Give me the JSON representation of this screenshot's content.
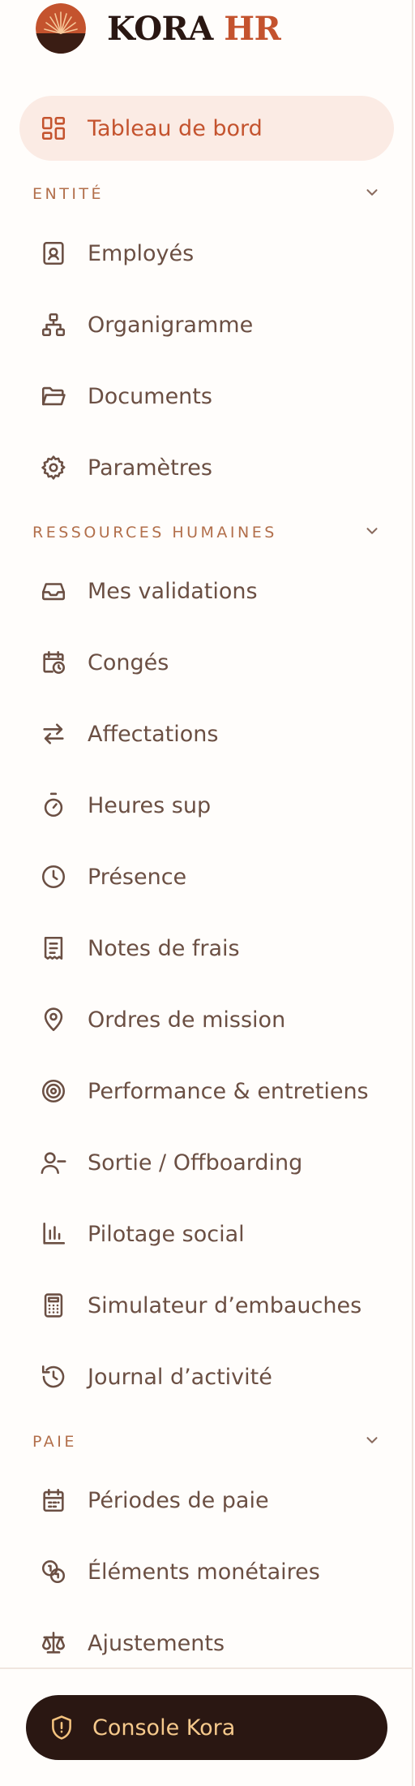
{
  "brand": {
    "name_part1": "KORA",
    "name_part2": "HR",
    "logo_icon": "sunrise-logo"
  },
  "colors": {
    "accent": "#c4532e",
    "active_bg": "#fbebe4",
    "text": "#6b4f43",
    "section": "#b26f4b",
    "dark": "#2a1712",
    "gold": "#f5c98c"
  },
  "nav": {
    "dashboard": {
      "label": "Tableau de bord",
      "icon": "grid-icon"
    },
    "sections": [
      {
        "label": "ENTITÉ",
        "items": [
          {
            "label": "Employés",
            "icon": "id-badge-icon"
          },
          {
            "label": "Organigramme",
            "icon": "org-chart-icon"
          },
          {
            "label": "Documents",
            "icon": "folder-icon"
          },
          {
            "label": "Paramètres",
            "icon": "gear-icon"
          }
        ]
      },
      {
        "label": "RESSOURCES HUMAINES",
        "items": [
          {
            "label": "Mes validations",
            "icon": "inbox-icon"
          },
          {
            "label": "Congés",
            "icon": "calendar-clock-icon"
          },
          {
            "label": "Affectations",
            "icon": "swap-arrows-icon"
          },
          {
            "label": "Heures sup",
            "icon": "stopwatch-icon"
          },
          {
            "label": "Présence",
            "icon": "clock-icon"
          },
          {
            "label": "Notes de frais",
            "icon": "receipt-icon"
          },
          {
            "label": "Ordres de mission",
            "icon": "map-pin-icon"
          },
          {
            "label": "Performance & entretiens",
            "icon": "target-icon"
          },
          {
            "label": "Sortie / Offboarding",
            "icon": "user-minus-icon"
          },
          {
            "label": "Pilotage social",
            "icon": "bar-chart-icon"
          },
          {
            "label": "Simulateur d’embauches",
            "icon": "calculator-icon"
          },
          {
            "label": "Journal d’activité",
            "icon": "history-icon"
          }
        ]
      },
      {
        "label": "PAIE",
        "items": [
          {
            "label": "Périodes de paie",
            "icon": "calendar-icon"
          },
          {
            "label": "Éléments monétaires",
            "icon": "coins-icon"
          },
          {
            "label": "Ajustements",
            "icon": "scale-icon"
          }
        ]
      }
    ]
  },
  "footer": {
    "console_label": "Console Kora",
    "icon": "shield-alert-icon"
  }
}
